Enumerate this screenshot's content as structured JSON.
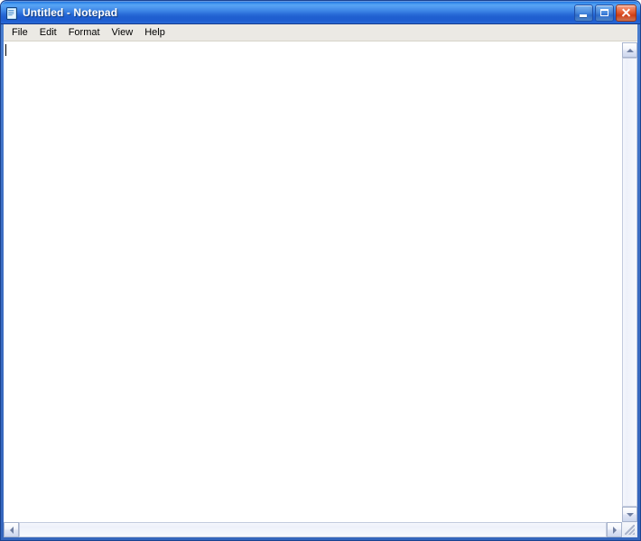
{
  "window": {
    "title": "Untitled - Notepad",
    "app_icon": "notepad-icon",
    "frame_color": "#3d6fc4",
    "titlebar_color": "#2e84e8",
    "close_button_color": "#d33f17"
  },
  "caption_buttons": {
    "minimize": {
      "name": "minimize-button",
      "tooltip": "Minimize"
    },
    "maximize": {
      "name": "maximize-button",
      "tooltip": "Maximize"
    },
    "close": {
      "name": "close-button",
      "tooltip": "Close"
    }
  },
  "menubar": {
    "items": [
      {
        "label": "File"
      },
      {
        "label": "Edit"
      },
      {
        "label": "Format"
      },
      {
        "label": "View"
      },
      {
        "label": "Help"
      }
    ]
  },
  "document": {
    "content": "",
    "caret_visible": true,
    "background_color": "#ffffff"
  },
  "scrollbars": {
    "vertical": {
      "up_arrow": "scroll-up-arrow",
      "down_arrow": "scroll-down-arrow",
      "thumb_visible": false
    },
    "horizontal": {
      "left_arrow": "scroll-left-arrow",
      "right_arrow": "scroll-right-arrow",
      "thumb_visible": false
    },
    "resize_grip": "resize-grip"
  }
}
